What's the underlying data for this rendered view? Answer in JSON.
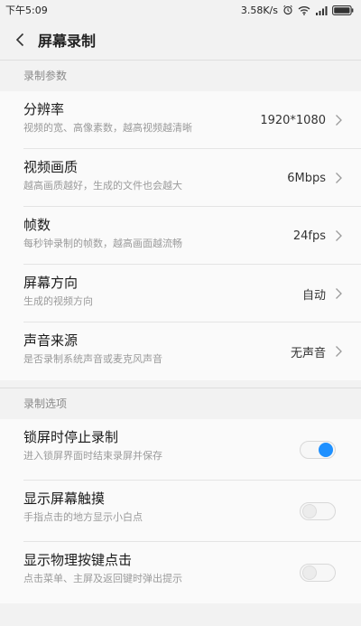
{
  "status": {
    "time": "下午5:09",
    "speed": "3.58K/s",
    "icons": [
      "alarm-icon",
      "wifi-icon",
      "signal-icon",
      "battery-icon"
    ]
  },
  "header": {
    "title": "屏幕录制"
  },
  "sections": [
    {
      "title": "录制参数",
      "items": [
        {
          "label": "分辨率",
          "desc": "视频的宽、高像素数，越高视频越清晰",
          "value": "1920*1080"
        },
        {
          "label": "视频画质",
          "desc": "越高画质越好，生成的文件也会越大",
          "value": "6Mbps"
        },
        {
          "label": "帧数",
          "desc": "每秒钟录制的帧数，越高画面越流畅",
          "value": "24fps"
        },
        {
          "label": "屏幕方向",
          "desc": "生成的视频方向",
          "value": "自动"
        },
        {
          "label": "声音来源",
          "desc": "是否录制系统声音或麦克风声音",
          "value": "无声音"
        }
      ]
    },
    {
      "title": "录制选项",
      "items": [
        {
          "label": "锁屏时停止录制",
          "desc": "进入锁屏界面时结束录屏并保存",
          "on": true
        },
        {
          "label": "显示屏幕触摸",
          "desc": "手指点击的地方显示小白点",
          "on": false
        },
        {
          "label": "显示物理按键点击",
          "desc": "点击菜单、主屏及返回键时弹出提示",
          "on": false
        }
      ]
    }
  ],
  "colors": {
    "accent": "#1e90ff",
    "background": "#f2f2f2",
    "card": "#fafafa"
  }
}
